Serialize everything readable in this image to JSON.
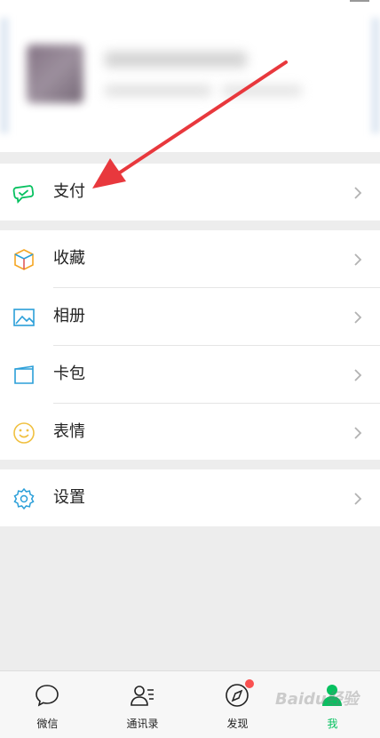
{
  "menu": {
    "pay": "支付",
    "favorites": "收藏",
    "album": "相册",
    "cards": "卡包",
    "stickers": "表情",
    "settings": "设置"
  },
  "tabs": [
    {
      "label": "微信"
    },
    {
      "label": "通讯录"
    },
    {
      "label": "发现"
    },
    {
      "label": "我"
    }
  ],
  "watermark": "Baidu经验",
  "colors": {
    "accent": "#07c160",
    "badge": "#fa5151",
    "arrow": "#e8383d"
  }
}
